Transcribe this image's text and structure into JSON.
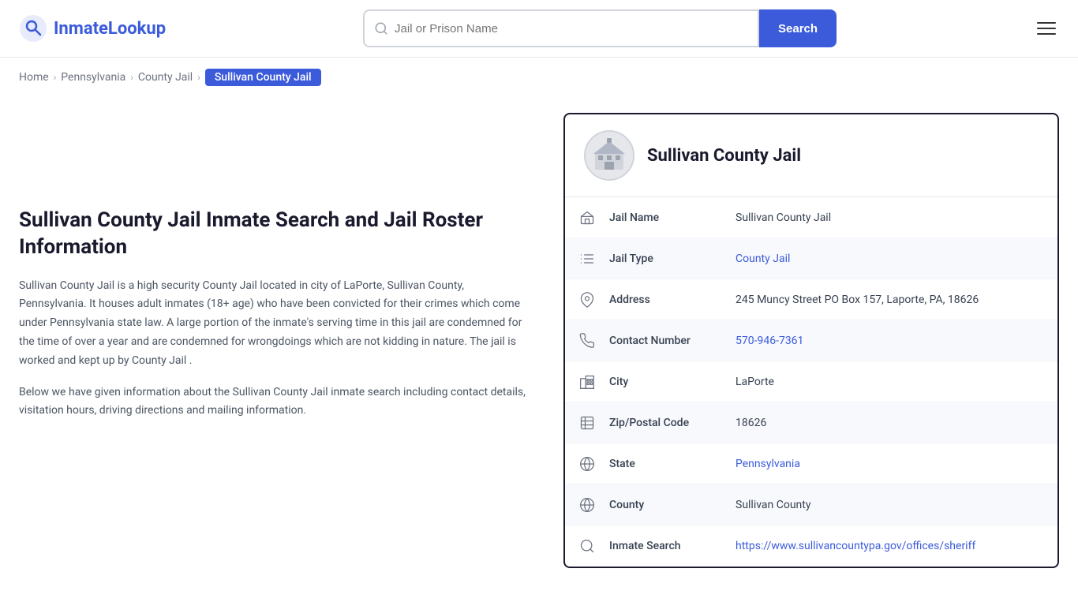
{
  "header": {
    "logo_text_1": "Inmate",
    "logo_text_2": "Lookup",
    "search_placeholder": "Jail or Prison Name",
    "search_button_label": "Search"
  },
  "breadcrumb": {
    "home": "Home",
    "state": "Pennsylvania",
    "type": "County Jail",
    "current": "Sullivan County Jail"
  },
  "left": {
    "title": "Sullivan County Jail Inmate Search and Jail Roster Information",
    "desc1": "Sullivan County Jail is a high security County Jail located in city of LaPorte, Sullivan County, Pennsylvania. It houses adult inmates (18+ age) who have been convicted for their crimes which come under Pennsylvania state law. A large portion of the inmate's serving time in this jail are condemned for the time of over a year and are condemned for wrongdoings which are not kidding in nature. The jail is worked and kept up by County Jail .",
    "desc2": "Below we have given information about the Sullivan County Jail inmate search including contact details, visitation hours, driving directions and mailing information."
  },
  "card": {
    "title": "Sullivan County Jail",
    "rows": [
      {
        "id": "jail-name",
        "label": "Jail Name",
        "value": "Sullivan County Jail",
        "link": null,
        "icon": "jail-icon",
        "shaded": false
      },
      {
        "id": "jail-type",
        "label": "Jail Type",
        "value": "County Jail",
        "link": "#",
        "icon": "type-icon",
        "shaded": true
      },
      {
        "id": "address",
        "label": "Address",
        "value": "245 Muncy Street PO Box 157, Laporte, PA, 18626",
        "link": null,
        "icon": "location-icon",
        "shaded": false
      },
      {
        "id": "contact",
        "label": "Contact Number",
        "value": "570-946-7361",
        "link": "tel:570-946-7361",
        "icon": "phone-icon",
        "shaded": true
      },
      {
        "id": "city",
        "label": "City",
        "value": "LaPorte",
        "link": null,
        "icon": "city-icon",
        "shaded": false
      },
      {
        "id": "zip",
        "label": "Zip/Postal Code",
        "value": "18626",
        "link": null,
        "icon": "zip-icon",
        "shaded": true
      },
      {
        "id": "state",
        "label": "State",
        "value": "Pennsylvania",
        "link": "#",
        "icon": "state-icon",
        "shaded": false
      },
      {
        "id": "county",
        "label": "County",
        "value": "Sullivan County",
        "link": null,
        "icon": "county-icon",
        "shaded": true
      },
      {
        "id": "inmate-search",
        "label": "Inmate Search",
        "value": "https://www.sullivancountypa.gov/offices/sheriff",
        "link": "https://www.sullivancountypa.gov/offices/sheriff",
        "icon": "search-icon",
        "shaded": false
      }
    ]
  }
}
